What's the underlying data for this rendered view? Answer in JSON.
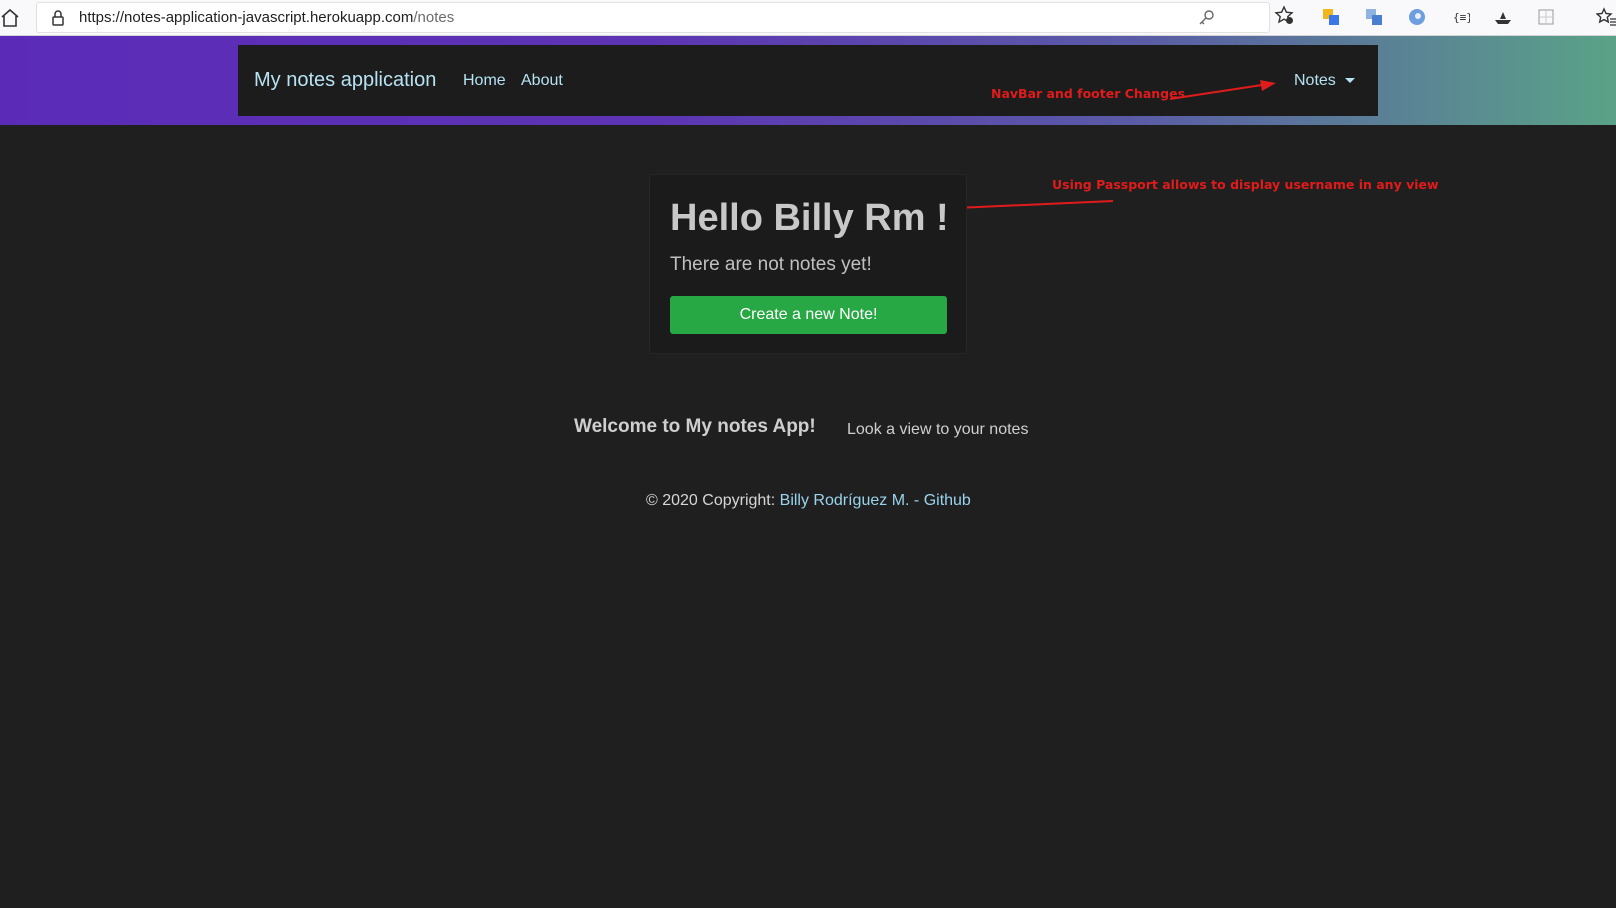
{
  "browser": {
    "url_host": "https://notes-application-javascript.herokuapp.com",
    "url_path": "/notes",
    "icons": [
      "home-icon",
      "lock-icon",
      "key-icon",
      "star-add-icon",
      "translate-icon",
      "translate-alt-icon",
      "firefox-icon",
      "json-icon",
      "boat-icon",
      "grid-icon",
      "favorites-icon"
    ]
  },
  "navbar": {
    "brand": "My notes application",
    "links": [
      "Home",
      "About"
    ],
    "dropdown_label": "Notes"
  },
  "annotations": {
    "navbar": "NavBar and footer Changes",
    "passport": "Using Passport allows to display username in any view"
  },
  "card": {
    "title": "Hello Billy Rm !",
    "text": "There are not notes yet!",
    "button": "Create a new Note!"
  },
  "footer": {
    "title": "Welcome to My notes App!",
    "subtitle": "Look a view to your notes",
    "copyright_prefix": "© 2020 Copyright: ",
    "author": "Billy Rodríguez M.",
    "separator": " - ",
    "github": "Github"
  },
  "colors": {
    "page_bg": "#1f1f1f",
    "navbar_bg": "#1c1c1c",
    "link": "#b6e2f2",
    "button": "#28a745",
    "annotation": "#e11b1b",
    "gradient_start": "#5b2bb8",
    "gradient_end": "#5aa287"
  }
}
